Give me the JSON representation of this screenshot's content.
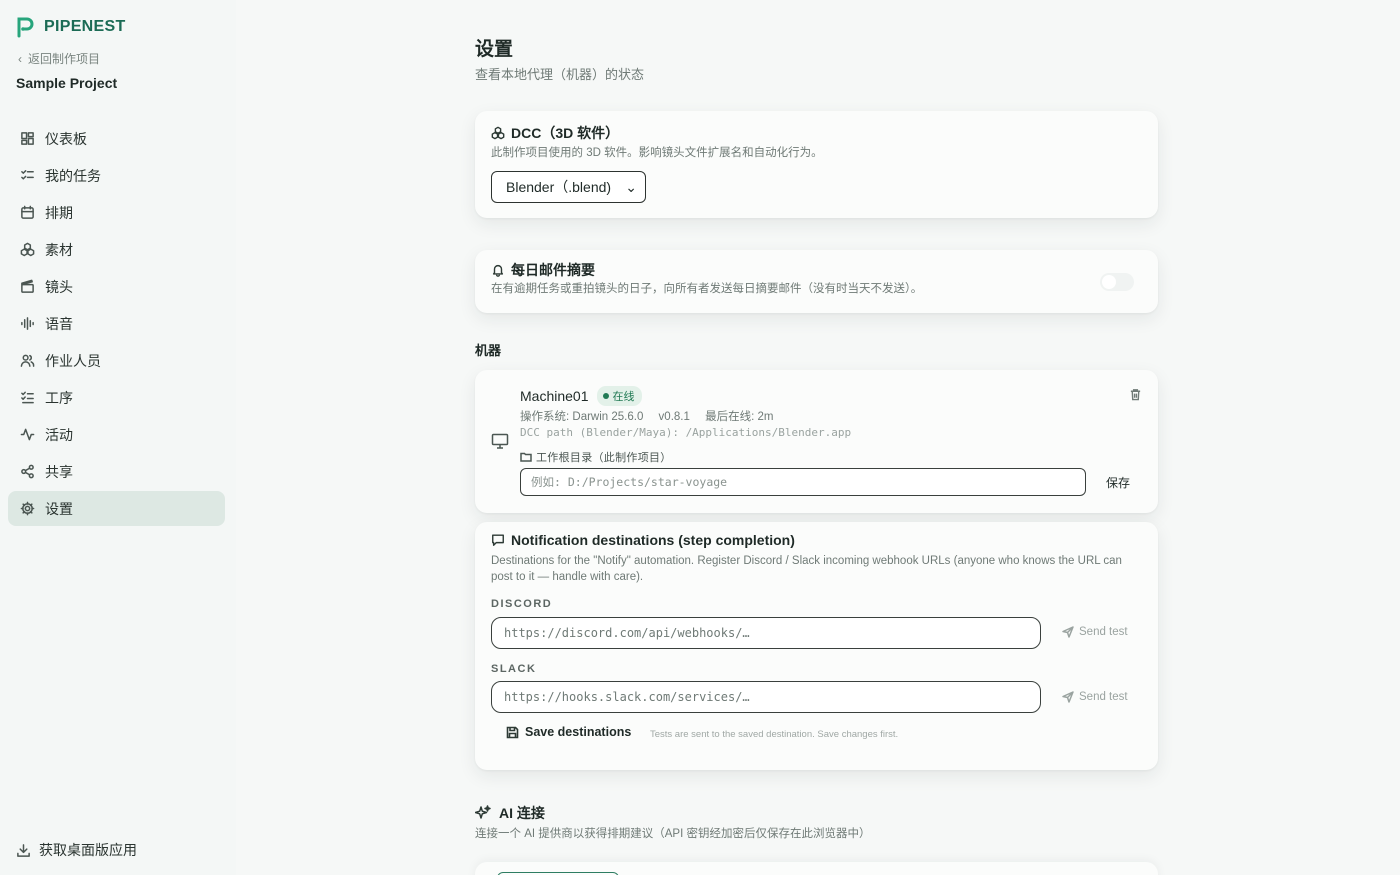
{
  "brand": {
    "name": "PIPENEST"
  },
  "sidebar": {
    "back_label": "返回制作项目",
    "project_name": "Sample Project",
    "items": [
      {
        "label": "仪表板",
        "icon": "dashboard-icon"
      },
      {
        "label": "我的任务",
        "icon": "tasks-icon"
      },
      {
        "label": "排期",
        "icon": "calendar-icon"
      },
      {
        "label": "素材",
        "icon": "assets-icon"
      },
      {
        "label": "镜头",
        "icon": "clapper-icon"
      },
      {
        "label": "语音",
        "icon": "audio-wave-icon"
      },
      {
        "label": "作业人员",
        "icon": "people-icon"
      },
      {
        "label": "工序",
        "icon": "checklist-icon"
      },
      {
        "label": "活动",
        "icon": "activity-icon"
      },
      {
        "label": "共享",
        "icon": "share-icon"
      },
      {
        "label": "设置",
        "icon": "gear-icon",
        "active": true
      }
    ],
    "get_app_label": "获取桌面版应用"
  },
  "page": {
    "title": "设置",
    "subtitle": "查看本地代理（机器）的状态"
  },
  "dcc_card": {
    "title": "DCC（3D 软件）",
    "description": "此制作项目使用的 3D 软件。影响镜头文件扩展名和自动化行为。",
    "selected": "Blender（.blend)"
  },
  "digest_card": {
    "title": "每日邮件摘要",
    "description": "在有逾期任务或重拍镜头的日子，向所有者发送每日摘要邮件（没有时当天不发送）。",
    "enabled": false
  },
  "machines": {
    "section_label": "机器",
    "items": [
      {
        "name": "Machine01",
        "status": "在线",
        "os": "操作系统: Darwin 25.6.0",
        "version": "v0.8.1",
        "last_online": "最后在线: 2m",
        "dcc_path": "DCC path (Blender/Maya): /Applications/Blender.app",
        "root_label": "工作根目录（此制作项目）",
        "root_placeholder": "例如: D:/Projects/star-voyage",
        "save_label": "保存"
      }
    ]
  },
  "notifications": {
    "title": "Notification destinations (step completion)",
    "description": "Destinations for the \"Notify\" automation. Register Discord / Slack incoming webhook URLs (anyone who knows the URL can post to it — handle with care).",
    "discord": {
      "label": "DISCORD",
      "placeholder": "https://discord.com/api/webhooks/…",
      "send_test": "Send test"
    },
    "slack": {
      "label": "SLACK",
      "placeholder": "https://hooks.slack.com/services/…",
      "send_test": "Send test"
    },
    "save_label": "Save destinations",
    "save_hint": "Tests are sent to the saved destination. Save changes first."
  },
  "ai": {
    "title": "AI 连接",
    "subtitle": "连接一个 AI 提供商以获得排期建议（API 密钥经加密后仅保存在此浏览器中）"
  },
  "colors": {
    "accent": "#1b6b55",
    "active_nav": "#dde8e3",
    "online": "#217a54"
  }
}
